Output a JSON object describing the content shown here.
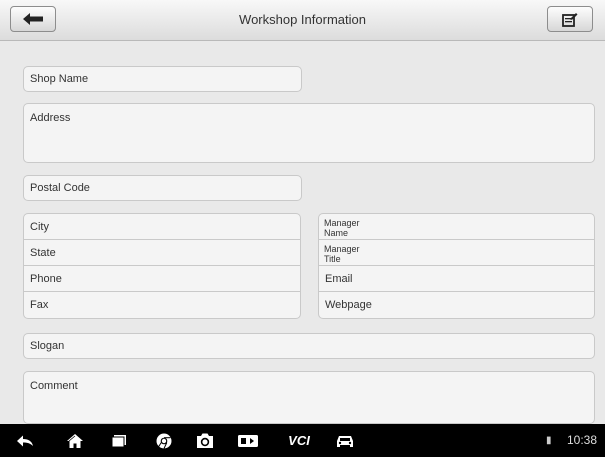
{
  "header": {
    "title": "Workshop Information",
    "back_icon": "back-arrow-icon",
    "edit_icon": "edit-icon"
  },
  "form": {
    "shop_name": "Shop Name",
    "address": "Address",
    "postal_code": "Postal Code",
    "city": "City",
    "state": "State",
    "phone": "Phone",
    "fax": "Fax",
    "manager_name_line1": "Manager",
    "manager_name_line2": "Name",
    "manager_title_line1": "Manager",
    "manager_title_line2": "Title",
    "email": "Email",
    "webpage": "Webpage",
    "slogan": "Slogan",
    "comment": "Comment"
  },
  "navbar": {
    "icons": [
      "back-icon",
      "home-icon",
      "recent-apps-icon",
      "chrome-icon",
      "camera-icon",
      "display-icon",
      "vci-icon",
      "car-icon"
    ],
    "vci_label": "VCI",
    "clock": "10:38"
  }
}
